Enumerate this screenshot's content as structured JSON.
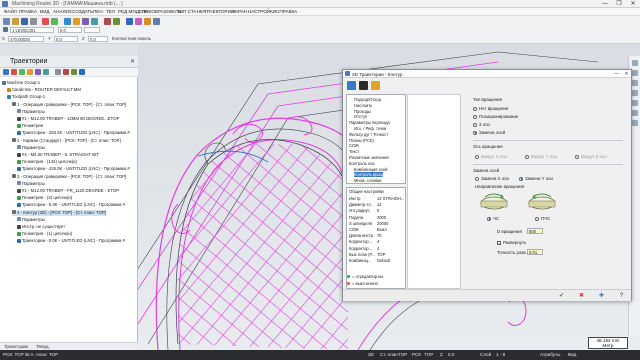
{
  "window": {
    "title": "Machining Router 3D - [ГАММА\\Машина.mtb (... ]",
    "buttons": [
      "—",
      "❐",
      "✕"
    ]
  },
  "menu": [
    "ФАЙЛ",
    "ПРАВКА",
    "ВИД",
    "АНАЛИЗ",
    "СОЗДАТЬ",
    "ПЕН",
    "ТЕЛ",
    "РЕД МОДЕЛЬ",
    "ПРЕОБРАЗОВАТЬ",
    "ТИП СТАНКА",
    "ТРАЕКТОРИИ",
    "ЭКРАН",
    "НАСТРОЙКИ",
    "СПРАВКА"
  ],
  "toolbar": {
    "level_value": "1 LEVEL001",
    "coord_value": "0.0",
    "x_value": "470.00025",
    "y_value": "0.0",
    "z_value": "0.0",
    "plane_label": "Контекстная панель"
  },
  "left_panel": {
    "title": "Траектории",
    "close": "✕",
    "tree": [
      {
        "indent": 0,
        "text": "Machine Group-1",
        "icon": "machine-icon",
        "color": "#5a6f8c"
      },
      {
        "indent": 1,
        "text": "Свойства - ROUTER DEFAULT.MM",
        "icon": "properties-icon",
        "color": "#c58b1b"
      },
      {
        "indent": 1,
        "text": "Toolpath Group-1",
        "icon": "group-icon",
        "color": "#3a78c6"
      },
      {
        "indent": 2,
        "text": "1 - Операция гравировки - [РСК: ТОР] - [Ст. план: ТОР]",
        "icon": "operation-icon",
        "color": "#6c6c6c"
      },
      {
        "indent": 3,
        "text": "Параметры",
        "icon": "params-icon",
        "color": "#6d8bb4"
      },
      {
        "indent": 3,
        "text": "#1 - M12.00 TRABEP - 12MM 90 DEGREE...ETOP",
        "icon": "tool-icon",
        "color": "#444"
      },
      {
        "indent": 3,
        "text": "Геометрия",
        "icon": "geometry-icon",
        "color": "#3aa04a"
      },
      {
        "indent": 3,
        "text": "Траектории - 263.2K - UNTITLED (LNC) - Программа #",
        "icon": "toolpath-icon",
        "color": "#2b6bbd"
      },
      {
        "indent": 2,
        "text": "2 - Карман (Стандарт) - [РСК: ТОР] - [Ст. план: ТОР]",
        "icon": "operation-icon",
        "color": "#6c6c6c"
      },
      {
        "indent": 3,
        "text": "Параметры",
        "icon": "params-icon",
        "color": "#6d8bb4"
      },
      {
        "indent": 3,
        "text": "#4 - M4.00 TRABEP - 8. STRAIGHT BIT",
        "icon": "tool-icon",
        "color": "#444"
      },
      {
        "indent": 3,
        "text": "Геометрия - (142) цепочк(и)",
        "icon": "geometry-icon",
        "color": "#3aa04a"
      },
      {
        "indent": 3,
        "text": "Траектории - 426.0K - UNTITLED (LNC) - Программа #",
        "icon": "toolpath-icon",
        "color": "#2b6bbd"
      },
      {
        "indent": 2,
        "text": "3 - Операция гравировки - [РСК: ТОР] - [Ст. план: ТОР]",
        "icon": "operation-icon",
        "color": "#6c6c6c"
      },
      {
        "indent": 3,
        "text": "Параметры",
        "icon": "params-icon",
        "color": "#6d8bb4"
      },
      {
        "indent": 3,
        "text": "#1 - M12.00 TRABEP - FR_1120 DEGREE - ETOP",
        "icon": "tool-icon",
        "color": "#444"
      },
      {
        "indent": 3,
        "text": "Геометрия - (2) цепочк(и)",
        "icon": "geometry-icon",
        "color": "#3aa04a"
      },
      {
        "indent": 3,
        "text": "Траектории - 9.3K - UNTITLED (LNC) - Программа #",
        "icon": "toolpath-icon",
        "color": "#2b6bbd"
      },
      {
        "indent": 2,
        "text": "4 - Контур (3D) - [РСК: ТОР] - [Ст. план: ТОР]",
        "icon": "operation-icon",
        "color": "#6c6c6c",
        "selected": true
      },
      {
        "indent": 3,
        "text": "Параметры",
        "icon": "params-icon",
        "color": "#6d8bb4"
      },
      {
        "indent": 3,
        "text": "Инстр. не существует",
        "icon": "tool-icon",
        "color": "#444"
      },
      {
        "indent": 3,
        "text": "Геометрия - (1) цепочк(и)",
        "icon": "geometry-icon",
        "color": "#3aa04a"
      },
      {
        "indent": 3,
        "text": "Траектории - 0.0K - UNTITLED (LNC) - Программа #",
        "icon": "toolpath-icon",
        "color": "#2b6bbd"
      }
    ],
    "tabs": [
      "Траектории",
      "Твёрд."
    ]
  },
  "dialog": {
    "title": "2D Траектории - Контур",
    "page_tree": [
      {
        "text": "Подход/Отход",
        "indent": 1
      },
      {
        "text": "Наслоить",
        "indent": 1
      },
      {
        "text": "Проходы",
        "indent": 1
      },
      {
        "text": "Отступ",
        "indent": 1
      },
      {
        "text": "Параметры перехода",
        "indent": 0
      },
      {
        "text": "Исх. / Реф. точки",
        "indent": 1
      },
      {
        "text": "Фильтр дуг / Точност",
        "indent": 0
      },
      {
        "text": "Планы (РСК)",
        "indent": 0
      },
      {
        "text": "СОЖ",
        "indent": 0
      },
      {
        "text": "Текст",
        "indent": 0
      },
      {
        "text": "Различные значения",
        "indent": 0
      },
      {
        "text": "Контроль оси",
        "indent": 0
      },
      {
        "text": "Комбинация осей",
        "indent": 1
      },
      {
        "text": "Контроль вращ",
        "indent": 1,
        "selected": true
      },
      {
        "text": "Множ. головки",
        "indent": 1
      }
    ],
    "settings_title": "Общие настройки",
    "settings": [
      [
        "Инстр",
        "12 STRAIGH..."
      ],
      [
        "Диаметр-гл.",
        "12"
      ],
      [
        "Угл.радиус",
        "0"
      ],
      [
        "Подача",
        "2000"
      ],
      [
        "S шпинделя",
        "20000"
      ],
      [
        "СОЖ",
        "Выкл"
      ],
      [
        "Длина инстр.",
        "75"
      ],
      [
        "Корректор...",
        "4"
      ],
      [
        "Корректор...",
        "4"
      ],
      [
        "Вых план (Р...",
        "TOP"
      ],
      [
        "Комбинац...",
        "Default"
      ]
    ],
    "legend": [
      "= отредактир.ны",
      "= выкл.ючено"
    ],
    "rotation_type_label": "Тип вращения",
    "rotation_types": [
      {
        "label": "Нет вращения",
        "on": false
      },
      {
        "label": "Позиционирование",
        "on": false
      },
      {
        "label": "3 оси",
        "on": false
      },
      {
        "label": "Замена осей",
        "on": true
      }
    ],
    "axis_label": "Ось вращения",
    "axes": [
      "Вокруг X оси",
      "Вокруг Y оси",
      "Вокруг Z оси"
    ],
    "axis_swap_label": "Замена осей",
    "axis_swap": [
      {
        "label": "Замена X оси",
        "on": false
      },
      {
        "label": "Замена Y оси",
        "on": true
      }
    ],
    "direction_label": "Направление вращения",
    "directions": [
      {
        "label": "ЧС",
        "on": true
      },
      {
        "label": "ПЧС",
        "on": false
      }
    ],
    "diameter_label": "D вращения",
    "diameter_value": "600",
    "unwrap_label": "Развернуть",
    "tolerance_label": "Точность разв.",
    "tolerance_value": "0.01"
  },
  "statusbar": {
    "left": "РСК: ТОР  Вг.А. план: ТОР",
    "mode": "3D",
    "plane_label": "Ст. план",
    "plane_value": "TOP",
    "wcs_label": "РСК",
    "wcs_value": "TOP",
    "z_label": "Z",
    "z_value": "0.0",
    "level_label": "Слой",
    "level_value": "1 - 8",
    "attr_label": "Атрибуты",
    "view_label": "Вид"
  },
  "scale": {
    "value": "48.154 mm",
    "unit": "Метр"
  },
  "colors": {
    "toolpath": "#e33ee3",
    "geometry": "#3b3f47",
    "accent": "#3a78c6"
  }
}
